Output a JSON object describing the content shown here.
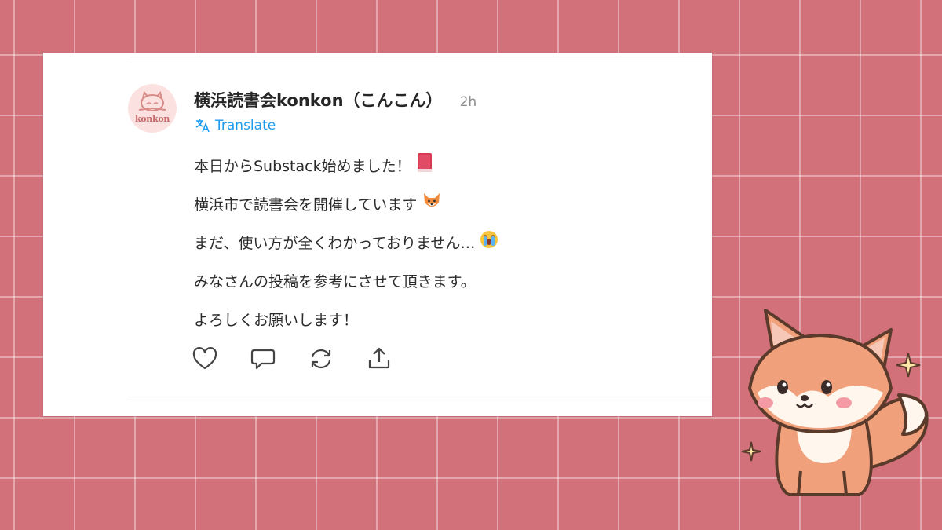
{
  "post": {
    "author": "横浜読書会konkon（こんこん）",
    "timestamp": "2h",
    "translate_label": "Translate",
    "avatar_text": "konkon",
    "lines": [
      "本日からSubstack始めました！",
      "横浜市で読書会を開催しています",
      "まだ、使い方が全くわかっておりません…",
      "みなさんの投稿を参考にさせて頂きます。",
      "よろしくお願いします！"
    ],
    "line_emojis": [
      "closed-book-emoji",
      "fox-face-emoji",
      "crying-face-emoji",
      "",
      ""
    ]
  },
  "actions": [
    {
      "name": "like-button",
      "icon": "heart-icon"
    },
    {
      "name": "comment-button",
      "icon": "comment-icon"
    },
    {
      "name": "restack-button",
      "icon": "restack-icon"
    },
    {
      "name": "share-button",
      "icon": "share-icon"
    }
  ],
  "colors": {
    "background": "#d2717a",
    "card": "#ffffff",
    "link": "#1d9bf0",
    "text": "#2b2b2b",
    "muted": "#8a8a8a"
  }
}
